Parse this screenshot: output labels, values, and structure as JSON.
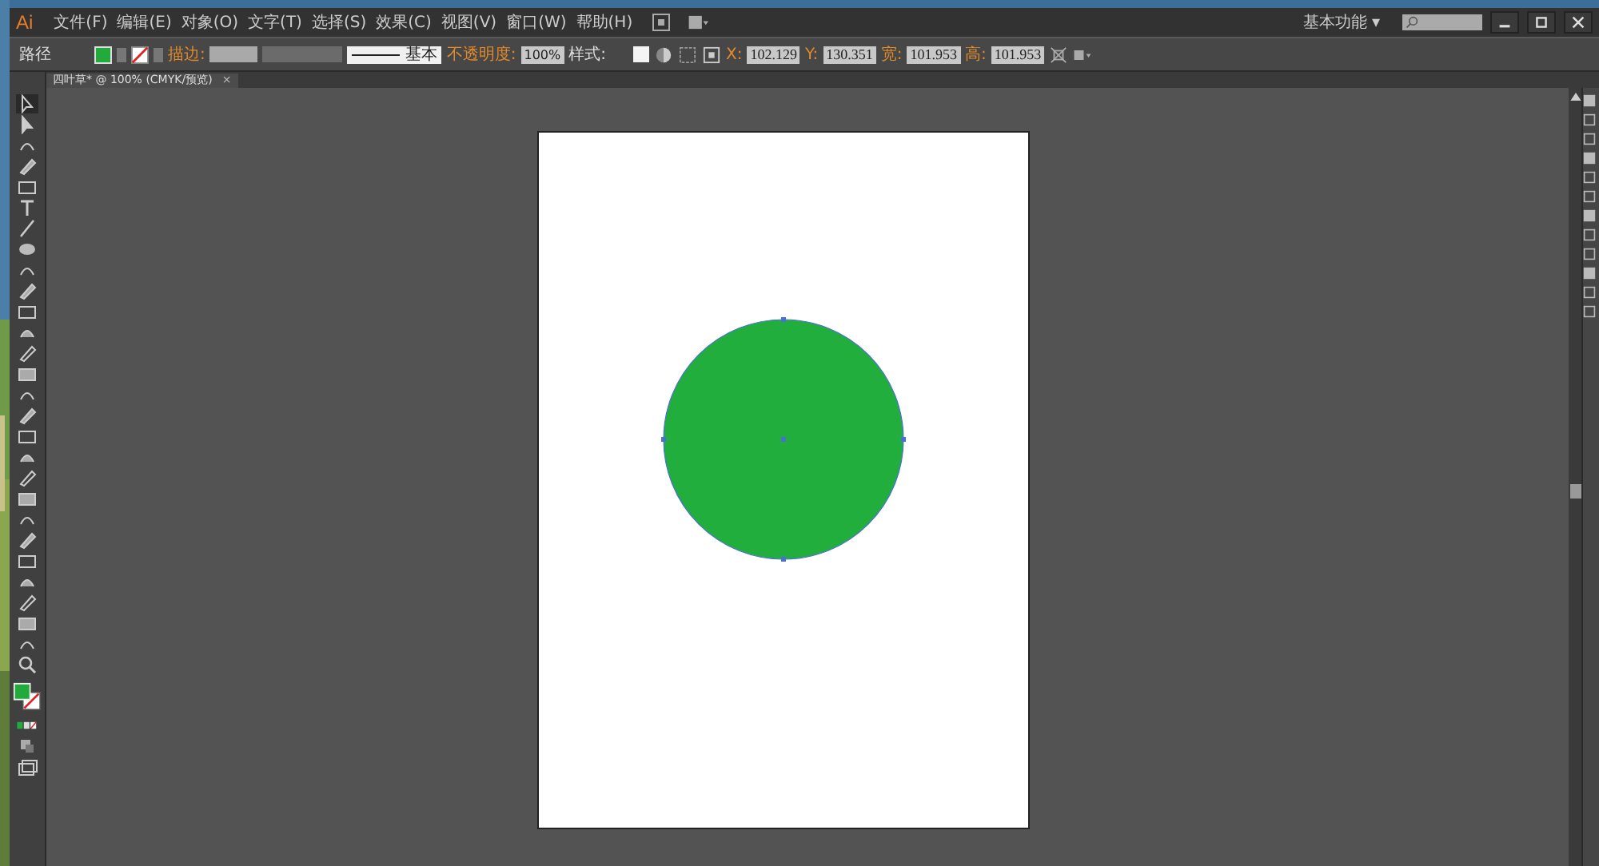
{
  "app": {
    "logo": "Ai"
  },
  "menu": [
    "文件(F)",
    "编辑(E)",
    "对象(O)",
    "文字(T)",
    "选择(S)",
    "效果(C)",
    "视图(V)",
    "窗口(W)",
    "帮助(H)"
  ],
  "workspace": {
    "label": "基本功能",
    "caret": "▾"
  },
  "control_bar": {
    "object_type": "路径",
    "stroke_label": "描边:",
    "stroke_profile": "基本",
    "opacity_label": "不透明度:",
    "opacity": "100%",
    "style_label": "样式:",
    "fields": [
      {
        "label": "X:",
        "value": "102.129"
      },
      {
        "label": "Y:",
        "value": "130.351"
      },
      {
        "label": "宽:",
        "value": "101.953"
      },
      {
        "label": "高:",
        "value": "101.953"
      }
    ]
  },
  "document_tab": {
    "title": "四叶草* @ 100% (CMYK/预览)",
    "close": "×"
  },
  "tools": [
    {
      "selected": true
    },
    {
      "selected": false
    },
    {
      "selected": false
    },
    {
      "selected": false
    },
    {
      "selected": false
    },
    {
      "selected": false
    },
    {
      "selected": false
    },
    {
      "selected": false
    },
    {
      "selected": false
    },
    {
      "selected": false
    },
    {
      "selected": false
    },
    {
      "selected": false
    },
    {
      "selected": false
    },
    {
      "selected": false
    },
    {
      "selected": false
    },
    {
      "selected": false
    },
    {
      "selected": false
    },
    {
      "selected": false
    },
    {
      "selected": false
    },
    {
      "selected": false
    },
    {
      "selected": false
    },
    {
      "selected": false
    },
    {
      "selected": false
    },
    {
      "selected": false
    },
    {
      "selected": false
    },
    {
      "selected": false
    },
    {
      "selected": false
    }
  ]
}
